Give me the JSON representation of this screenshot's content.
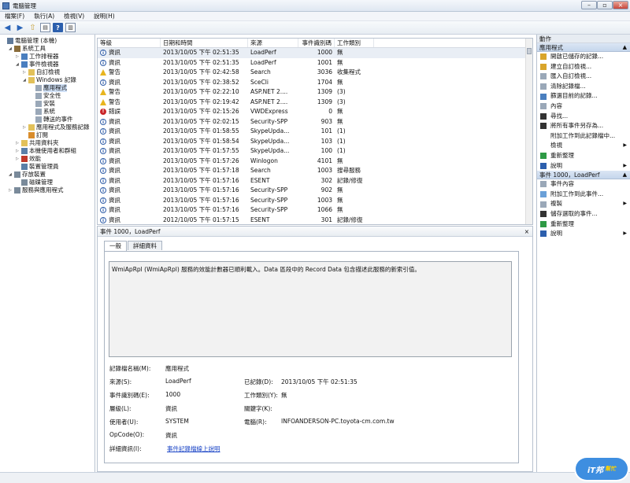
{
  "window": {
    "title": "電腦管理"
  },
  "menu": [
    "檔案(F)",
    "執行(A)",
    "檢視(V)",
    "說明(H)"
  ],
  "tree": [
    {
      "label": "電腦管理 (本機)",
      "indent": 0,
      "toggle": "",
      "icon": "computer-icon",
      "color": "#607a9a"
    },
    {
      "label": "系統工具",
      "indent": 1,
      "toggle": "◢",
      "icon": "tools-icon",
      "color": "#8a6d3b"
    },
    {
      "label": "工作排程器",
      "indent": 2,
      "toggle": "▷",
      "icon": "clock-icon",
      "color": "#4a7fbf"
    },
    {
      "label": "事件檢視器",
      "indent": 2,
      "toggle": "◢",
      "icon": "event-viewer-icon",
      "color": "#4a7fbf"
    },
    {
      "label": "自訂檢視",
      "indent": 3,
      "toggle": "▷",
      "icon": "folder-icon",
      "color": "#e2c15a"
    },
    {
      "label": "Windows 記錄",
      "indent": 3,
      "toggle": "◢",
      "icon": "folder-icon",
      "color": "#e2c15a"
    },
    {
      "label": "應用程式",
      "indent": 4,
      "toggle": "",
      "icon": "log-icon",
      "color": "#9aa8b8",
      "selected": true
    },
    {
      "label": "安全性",
      "indent": 4,
      "toggle": "",
      "icon": "log-icon",
      "color": "#9aa8b8"
    },
    {
      "label": "安裝",
      "indent": 4,
      "toggle": "",
      "icon": "log-icon",
      "color": "#9aa8b8"
    },
    {
      "label": "系統",
      "indent": 4,
      "toggle": "",
      "icon": "log-icon",
      "color": "#9aa8b8"
    },
    {
      "label": "轉送的事件",
      "indent": 4,
      "toggle": "",
      "icon": "log-icon",
      "color": "#9aa8b8"
    },
    {
      "label": "應用程式及服務記錄",
      "indent": 3,
      "toggle": "▷",
      "icon": "folder-icon",
      "color": "#e2c15a"
    },
    {
      "label": "訂閱",
      "indent": 3,
      "toggle": "",
      "icon": "subscription-icon",
      "color": "#d98c2b"
    },
    {
      "label": "共用資料夾",
      "indent": 2,
      "toggle": "▷",
      "icon": "shared-folder-icon",
      "color": "#e2c15a"
    },
    {
      "label": "本機使用者和群組",
      "indent": 2,
      "toggle": "▷",
      "icon": "users-icon",
      "color": "#5a7fa8"
    },
    {
      "label": "效能",
      "indent": 2,
      "toggle": "▷",
      "icon": "performance-icon",
      "color": "#c0392b"
    },
    {
      "label": "裝置管理員",
      "indent": 2,
      "toggle": "",
      "icon": "device-manager-icon",
      "color": "#5a7fa8"
    },
    {
      "label": "存放裝置",
      "indent": 1,
      "toggle": "◢",
      "icon": "storage-icon",
      "color": "#7a8a9a"
    },
    {
      "label": "磁碟管理",
      "indent": 2,
      "toggle": "",
      "icon": "disk-icon",
      "color": "#7a8a9a"
    },
    {
      "label": "服務與應用程式",
      "indent": 1,
      "toggle": "▷",
      "icon": "services-icon",
      "color": "#7a8a9a"
    }
  ],
  "events": {
    "columns": [
      "等級",
      "日期和時間",
      "來源",
      "事件識別碼",
      "工作類別"
    ],
    "rows": [
      {
        "level": "資訊",
        "type": "info",
        "date": "2013/10/05 下午 02:51:35",
        "source": "LoadPerf",
        "id": "1000",
        "category": "無",
        "selected": true
      },
      {
        "level": "資訊",
        "type": "info",
        "date": "2013/10/05 下午 02:51:35",
        "source": "LoadPerf",
        "id": "1001",
        "category": "無"
      },
      {
        "level": "警告",
        "type": "warn",
        "date": "2013/10/05 下午 02:42:58",
        "source": "Search",
        "id": "3036",
        "category": "收集程式"
      },
      {
        "level": "資訊",
        "type": "info",
        "date": "2013/10/05 下午 02:38:52",
        "source": "SceCli",
        "id": "1704",
        "category": "無"
      },
      {
        "level": "警告",
        "type": "warn",
        "date": "2013/10/05 下午 02:22:10",
        "source": "ASP.NET 2....",
        "id": "1309",
        "category": "(3)"
      },
      {
        "level": "警告",
        "type": "warn",
        "date": "2013/10/05 下午 02:19:42",
        "source": "ASP.NET 2....",
        "id": "1309",
        "category": "(3)"
      },
      {
        "level": "錯誤",
        "type": "err",
        "date": "2013/10/05 下午 02:15:26",
        "source": "VWDExpress",
        "id": "0",
        "category": "無"
      },
      {
        "level": "資訊",
        "type": "info",
        "date": "2013/10/05 下午 02:02:15",
        "source": "Security-SPP",
        "id": "903",
        "category": "無"
      },
      {
        "level": "資訊",
        "type": "info",
        "date": "2013/10/05 下午 01:58:55",
        "source": "SkypeUpda...",
        "id": "101",
        "category": "(1)"
      },
      {
        "level": "資訊",
        "type": "info",
        "date": "2013/10/05 下午 01:58:54",
        "source": "SkypeUpda...",
        "id": "103",
        "category": "(1)"
      },
      {
        "level": "資訊",
        "type": "info",
        "date": "2013/10/05 下午 01:57:55",
        "source": "SkypeUpda...",
        "id": "100",
        "category": "(1)"
      },
      {
        "level": "資訊",
        "type": "info",
        "date": "2013/10/05 下午 01:57:26",
        "source": "Winlogon",
        "id": "4101",
        "category": "無"
      },
      {
        "level": "資訊",
        "type": "info",
        "date": "2013/10/05 下午 01:57:18",
        "source": "Search",
        "id": "1003",
        "category": "搜尋服務"
      },
      {
        "level": "資訊",
        "type": "info",
        "date": "2013/10/05 下午 01:57:16",
        "source": "ESENT",
        "id": "302",
        "category": "記錄/修復"
      },
      {
        "level": "資訊",
        "type": "info",
        "date": "2013/10/05 下午 01:57:16",
        "source": "Security-SPP",
        "id": "902",
        "category": "無"
      },
      {
        "level": "資訊",
        "type": "info",
        "date": "2013/10/05 下午 01:57:16",
        "source": "Security-SPP",
        "id": "1003",
        "category": "無"
      },
      {
        "level": "資訊",
        "type": "info",
        "date": "2013/10/05 下午 01:57:16",
        "source": "Security-SPP",
        "id": "1066",
        "category": "無"
      },
      {
        "level": "資訊",
        "type": "info",
        "date": "2012/10/05 下午 01:57:15",
        "source": "ESENT",
        "id": "301",
        "category": "記錄/修復"
      }
    ]
  },
  "detail": {
    "header": "事件 1000，LoadPerf",
    "close": "×",
    "tabs": [
      "一般",
      "詳細資料"
    ],
    "description": "WmiApRpl (WmiApRpl) 服務的效能計數器已順利載入。Data 區段中的 Record Data 包含描述此服務的新索引值。",
    "fields": {
      "log_name_label": "記錄檔名稱(M):",
      "log_name": "應用程式",
      "source_label": "來源(S):",
      "source": "LoadPerf",
      "logged_label": "已記錄(D):",
      "logged": "2013/10/05 下午 02:51:35",
      "event_id_label": "事件識別碼(E):",
      "event_id": "1000",
      "task_label": "工作類別(Y):",
      "task": "無",
      "level_label": "層級(L):",
      "level": "資訊",
      "keywords_label": "關鍵字(K):",
      "keywords": "",
      "user_label": "使用者(U):",
      "user": "SYSTEM",
      "computer_label": "電腦(R):",
      "computer": "INFOANDERSON-PC.toyota-cm.com.tw",
      "opcode_label": "OpCode(O):",
      "opcode": "資訊",
      "more_info_label": "詳細資訊(I):",
      "more_info": "事件記錄檔線上說明"
    }
  },
  "actions": {
    "header": "動作",
    "section1": {
      "title": "應用程式",
      "items": [
        {
          "label": "開啟已儲存的記錄...",
          "icon": "open-log-icon",
          "color": "#d9a52b"
        },
        {
          "label": "建立自訂檢視...",
          "icon": "filter-icon",
          "color": "#d9a52b"
        },
        {
          "label": "匯入自訂檢視...",
          "icon": "import-icon",
          "color": "#9aa8b8"
        },
        {
          "label": "清除記錄檔...",
          "icon": "clear-icon",
          "color": "#9aa8b8"
        },
        {
          "label": "篩選目前的記錄...",
          "icon": "filter-icon",
          "color": "#4a7fbf"
        },
        {
          "label": "內容",
          "icon": "properties-icon",
          "color": "#9aa8b8"
        },
        {
          "label": "尋找...",
          "icon": "find-icon",
          "color": "#333333"
        },
        {
          "label": "將所有事件另存為...",
          "icon": "save-icon",
          "color": "#333333"
        },
        {
          "label": "附加工作到此記錄檔中...",
          "icon": "none",
          "color": ""
        },
        {
          "label": "檢視",
          "icon": "none",
          "color": "",
          "arrow": "▶"
        },
        {
          "label": "重新整理",
          "icon": "refresh-icon",
          "color": "#2e9a45"
        },
        {
          "label": "說明",
          "icon": "help-icon",
          "color": "#2c5fad",
          "arrow": "▶"
        }
      ]
    },
    "section2": {
      "title": "事件 1000，LoadPerf",
      "items": [
        {
          "label": "事件內容",
          "icon": "event-properties-icon",
          "color": "#9aa8b8"
        },
        {
          "label": "附加工作到此事件...",
          "icon": "attach-task-icon",
          "color": "#6aa0d8"
        },
        {
          "label": "複製",
          "icon": "copy-icon",
          "color": "#9aa8b8",
          "arrow": "▶"
        },
        {
          "label": "儲存選取的事件...",
          "icon": "save-icon",
          "color": "#333333"
        },
        {
          "label": "重新整理",
          "icon": "refresh-icon",
          "color": "#2e9a45"
        },
        {
          "label": "說明",
          "icon": "help-icon",
          "color": "#2c5fad",
          "arrow": "▶"
        }
      ]
    },
    "collapse": "▲"
  },
  "watermark": {
    "brand": "iT邦",
    "sub": "幫忙"
  }
}
